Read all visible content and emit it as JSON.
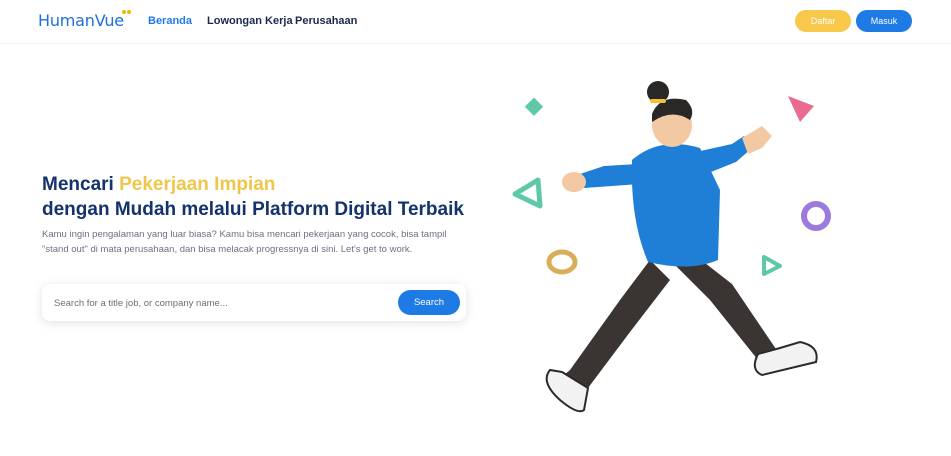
{
  "brand": {
    "name": "HumanVue"
  },
  "nav": {
    "links": [
      {
        "label": "Beranda",
        "active": true
      },
      {
        "label": "Lowongan Kerja",
        "active": false
      },
      {
        "label": "Perusahaan",
        "active": false
      }
    ],
    "register_label": "Daftar",
    "login_label": "Masuk"
  },
  "hero": {
    "headline_prefix": "Mencari ",
    "headline_accent": "Pekerjaan Impian",
    "headline_line2": "dengan Mudah melalui Platform Digital Terbaik",
    "subtitle": "Kamu ingin pengalaman yang luar biasa? Kamu bisa mencari pekerjaan yang cocok, bisa tampil \"stand out\" di mata perusahaan, dan bisa melacak progressnya di sini. Let's get to work."
  },
  "search": {
    "placeholder": "Search for a title job, or company name...",
    "value": "",
    "button_label": "Search"
  },
  "colors": {
    "primary": "#1e7be6",
    "navy": "#14326b",
    "accent_yellow": "#f0c64a",
    "register_button": "#f8c84b"
  }
}
